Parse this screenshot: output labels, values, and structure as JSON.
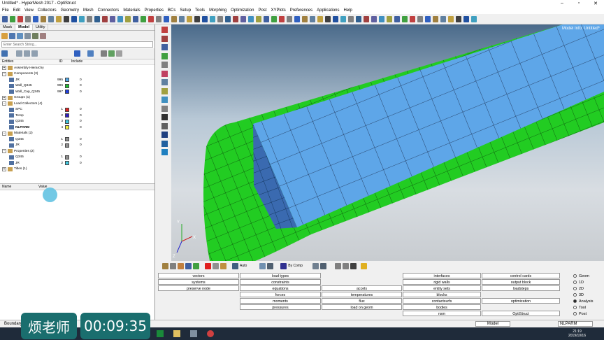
{
  "window": {
    "title": "Untitled* - HyperMesh 2017 - OptiStruct"
  },
  "menu": [
    "File",
    "Edit",
    "View",
    "Collectors",
    "Geometry",
    "Mesh",
    "Connectors",
    "Materials",
    "Properties",
    "BCs",
    "Setup",
    "Tools",
    "Morphing",
    "Optimization",
    "Post",
    "XYPlots",
    "Preferences",
    "Applications",
    "Help"
  ],
  "browser": {
    "tabs": [
      "Mask",
      "Model",
      "Utility"
    ],
    "search_placeholder": "Enter Search String...",
    "col_entities": "Entities",
    "col_id": "ID",
    "col_include": "Include",
    "rows": [
      {
        "label": "Assembly Hierarchy",
        "level": 0,
        "exp": "+",
        "id": "",
        "color": "",
        "include": ""
      },
      {
        "label": "Components (3)",
        "level": 0,
        "exp": "-",
        "id": "",
        "color": "",
        "include": ""
      },
      {
        "label": "JR",
        "level": 1,
        "exp": "",
        "id": "995",
        "color": "#4fa8e8",
        "include": "0"
      },
      {
        "label": "Wall_Q345",
        "level": 1,
        "exp": "",
        "id": "996",
        "color": "#20c030",
        "include": "0"
      },
      {
        "label": "Wall_Cap_Q345",
        "level": 1,
        "exp": "",
        "id": "997",
        "color": "#2040e0",
        "include": "0"
      },
      {
        "label": "Groups (1)",
        "level": 0,
        "exp": "+",
        "id": "",
        "color": "",
        "include": ""
      },
      {
        "label": "Load Collectors (4)",
        "level": 0,
        "exp": "-",
        "id": "",
        "color": "",
        "include": ""
      },
      {
        "label": "SPC",
        "level": 1,
        "exp": "",
        "id": "1",
        "color": "#e02020",
        "include": "0"
      },
      {
        "label": "Temp",
        "level": 1,
        "exp": "",
        "id": "2",
        "color": "#3020c0",
        "include": "0"
      },
      {
        "label": "Q345",
        "level": 1,
        "exp": "",
        "id": "3",
        "color": "#40c8e0",
        "include": "0"
      },
      {
        "label": "NLPARM",
        "level": 1,
        "exp": "",
        "id": "4",
        "color": "#f0f040",
        "include": "0"
      },
      {
        "label": "Materials (2)",
        "level": 0,
        "exp": "-",
        "id": "",
        "color": "",
        "include": ""
      },
      {
        "label": "Q345",
        "level": 1,
        "exp": "",
        "id": "1",
        "color": "#909090",
        "include": "0"
      },
      {
        "label": "JR",
        "level": 1,
        "exp": "",
        "id": "2",
        "color": "#909090",
        "include": "0"
      },
      {
        "label": "Properties (2)",
        "level": 0,
        "exp": "-",
        "id": "",
        "color": "",
        "include": ""
      },
      {
        "label": "Q345",
        "level": 1,
        "exp": "",
        "id": "1",
        "color": "#909090",
        "include": "0"
      },
      {
        "label": "JR",
        "level": 1,
        "exp": "",
        "id": "2",
        "color": "#40c8e0",
        "include": "0"
      },
      {
        "label": "Titles (1)",
        "level": 0,
        "exp": "+",
        "id": "",
        "color": "",
        "include": ""
      }
    ],
    "attr_name": "Name",
    "attr_value": "Value"
  },
  "viewport": {
    "model_info": "Model Info: Untitled*"
  },
  "vtools": {
    "auto": "Auto",
    "bycomp": "By Comp"
  },
  "panels": {
    "col1": [
      "vectors",
      "systems",
      "preserve node"
    ],
    "col2": [
      "load types",
      "constraints",
      "equations",
      "forces",
      "moments",
      "pressures"
    ],
    "col3": [
      "",
      "",
      "accels",
      "temperatures",
      "flux",
      "load on geom"
    ],
    "col4": [
      "interfaces",
      "rigid walls",
      "entity sets",
      "blocks",
      "contactsurfs",
      "bodies",
      "nsm"
    ],
    "col5": [
      "control cards",
      "output block",
      "loadsteps",
      "",
      "optimization",
      "",
      "OptiStruct"
    ]
  },
  "radio": {
    "items": [
      "Geom",
      "1D",
      "2D",
      "3D",
      "Analysis",
      "Tool",
      "Post"
    ],
    "selected": "Analysis"
  },
  "status": {
    "left": "Boundary",
    "model": "Model",
    "collector": "NLPARM"
  },
  "taskbar": {
    "time": "21:19",
    "date": "2019/10/16"
  },
  "overlay": {
    "name": "烦老师",
    "timer": "00:09:35"
  }
}
